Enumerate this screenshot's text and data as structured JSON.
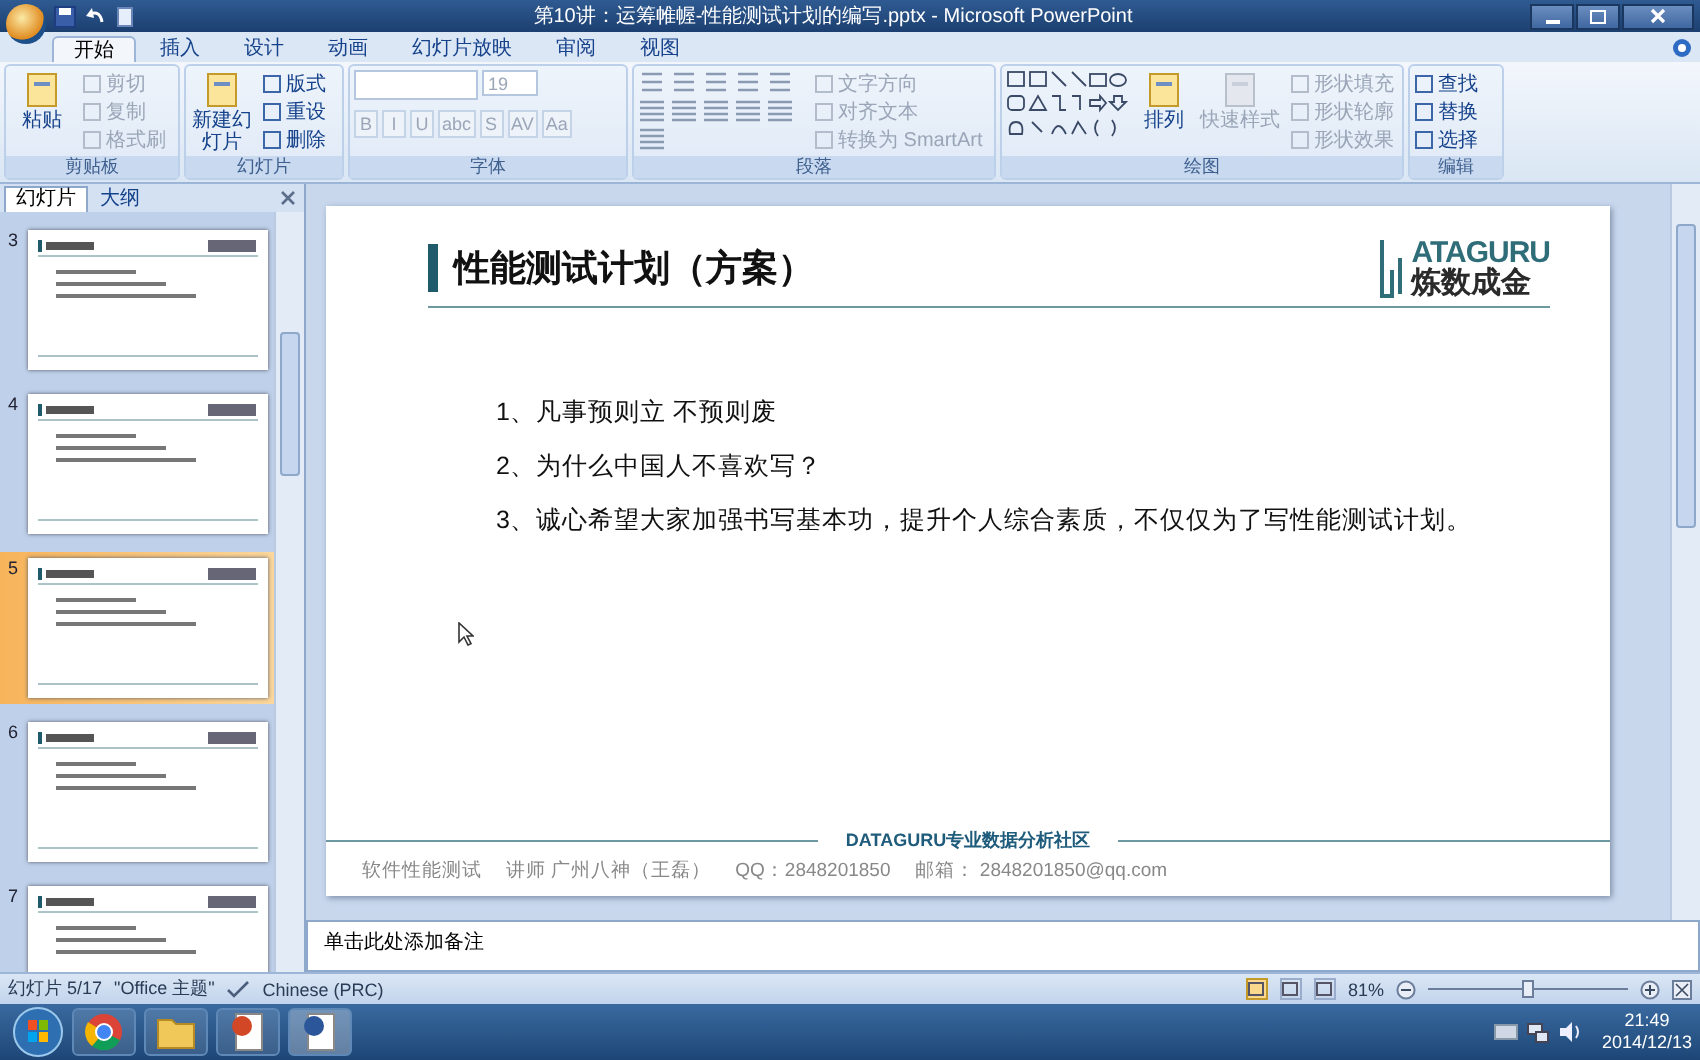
{
  "window": {
    "title": "第10讲：运筹帷幄-性能测试计划的编写.pptx - Microsoft PowerPoint"
  },
  "tabs": [
    {
      "label": "开始",
      "selected": true
    },
    {
      "label": "插入",
      "selected": false
    },
    {
      "label": "设计",
      "selected": false
    },
    {
      "label": "动画",
      "selected": false
    },
    {
      "label": "幻灯片放映",
      "selected": false
    },
    {
      "label": "审阅",
      "selected": false
    },
    {
      "label": "视图",
      "selected": false
    }
  ],
  "ribbon": {
    "groups": [
      {
        "label": "剪贴板",
        "items": [
          {
            "kind": "large",
            "label": "粘贴",
            "disabled": false
          },
          {
            "kind": "small",
            "label": "剪切",
            "disabled": true
          },
          {
            "kind": "small",
            "label": "复制",
            "disabled": true
          },
          {
            "kind": "small",
            "label": "格式刷",
            "disabled": true
          }
        ]
      },
      {
        "label": "幻灯片",
        "items": [
          {
            "kind": "large",
            "label": "新建幻灯片",
            "disabled": false
          },
          {
            "kind": "small",
            "label": "版式",
            "disabled": false
          },
          {
            "kind": "small",
            "label": "重设",
            "disabled": false
          },
          {
            "kind": "small",
            "label": "删除",
            "disabled": false
          }
        ]
      },
      {
        "label": "字体",
        "items": [
          {
            "kind": "font_size",
            "label": "19",
            "disabled": true
          },
          {
            "kind": "format",
            "label": "B",
            "disabled": true
          },
          {
            "kind": "format",
            "label": "I",
            "disabled": true
          },
          {
            "kind": "format",
            "label": "U",
            "disabled": true
          },
          {
            "kind": "format",
            "label": "abc",
            "disabled": true
          },
          {
            "kind": "format",
            "label": "S",
            "disabled": true
          },
          {
            "kind": "format",
            "label": "AV",
            "disabled": true
          },
          {
            "kind": "format",
            "label": "Aa",
            "disabled": true
          }
        ]
      },
      {
        "label": "段落",
        "items": [
          {
            "kind": "small",
            "label": "文字方向",
            "disabled": true
          },
          {
            "kind": "small",
            "label": "对齐文本",
            "disabled": true
          },
          {
            "kind": "small",
            "label": "转换为 SmartArt",
            "disabled": true
          }
        ]
      },
      {
        "label": "绘图",
        "items": [
          {
            "kind": "large",
            "label": "排列",
            "disabled": false
          },
          {
            "kind": "large",
            "label": "快速样式",
            "disabled": true
          },
          {
            "kind": "small",
            "label": "形状填充",
            "disabled": true
          },
          {
            "kind": "small",
            "label": "形状轮廓",
            "disabled": true
          },
          {
            "kind": "small",
            "label": "形状效果",
            "disabled": true
          }
        ]
      },
      {
        "label": "编辑",
        "items": [
          {
            "kind": "small",
            "label": "查找",
            "disabled": false
          },
          {
            "kind": "small",
            "label": "替换",
            "disabled": false
          },
          {
            "kind": "small",
            "label": "选择",
            "disabled": false
          }
        ]
      }
    ]
  },
  "slides_pane": {
    "tabs": [
      {
        "label": "幻灯片",
        "selected": true
      },
      {
        "label": "大纲",
        "selected": false
      }
    ],
    "thumbnails": [
      {
        "number": "3",
        "selected": false
      },
      {
        "number": "4",
        "selected": false
      },
      {
        "number": "5",
        "selected": true
      },
      {
        "number": "6",
        "selected": false
      },
      {
        "number": "7",
        "selected": false
      }
    ]
  },
  "slide": {
    "title": "性能测试计划（方案）",
    "logo": {
      "letters": "ATAGURU",
      "tagline": "炼数成金"
    },
    "points": [
      "1、凡事预则立 不预则废",
      "2、为什么中国人不喜欢写？",
      "3、诚心希望大家加强书写基本功，提升个人综合素质，不仅仅为了写性能测试计划。"
    ],
    "footer": {
      "banner": "DATAGURU专业数据分析社区",
      "items": [
        "软件性能测试",
        "讲师 广州八神（王磊）",
        "QQ：2848201850",
        "邮箱： 2848201850@qq.com"
      ]
    }
  },
  "notes": {
    "placeholder": "单击此处添加备注"
  },
  "status_bar": {
    "slide": "幻灯片 5/17",
    "theme": "\"Office 主题\"",
    "language": "Chinese (PRC)",
    "views": [
      {
        "selected": true
      },
      {
        "selected": false
      },
      {
        "selected": false
      }
    ],
    "zoom": "81%",
    "zoom_slider": {
      "level": 0.5
    }
  },
  "taskbar": {
    "time": "21:49",
    "date": "2014/12/13"
  }
}
